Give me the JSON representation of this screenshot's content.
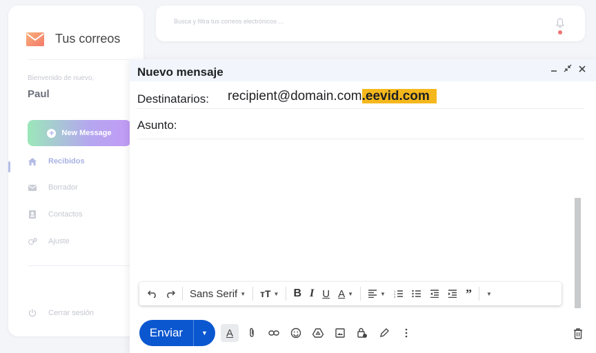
{
  "app": {
    "title": "Tus correos",
    "welcome": "Bienvenido de nuevo,",
    "user_name": "Paul"
  },
  "sidebar": {
    "new_message_label": "New Message",
    "items": [
      {
        "label": "Recibidos",
        "icon": "home-icon",
        "active": true
      },
      {
        "label": "Borrador",
        "icon": "envelope-icon",
        "active": false
      },
      {
        "label": "Contactos",
        "icon": "contact-card-icon",
        "active": false
      },
      {
        "label": "Ajuste",
        "icon": "gears-icon",
        "active": false
      }
    ],
    "logout_label": "Cerrar sesión"
  },
  "search": {
    "placeholder": "Busca y filtra tus correos electrónicos ..."
  },
  "compose": {
    "title": "Nuevo mensaje",
    "to_label": "Destinatarios:",
    "to_value_plain": "recipient@domain.com",
    "to_value_highlight": ".eevid.com",
    "subject_label": "Asunto:",
    "font_name": "Sans Serif",
    "send_label": "Enviar"
  },
  "colors": {
    "accent": "#0b57d0",
    "highlight": "#f5b81c",
    "logo": "#f89a6b",
    "notification": "#f17272"
  }
}
